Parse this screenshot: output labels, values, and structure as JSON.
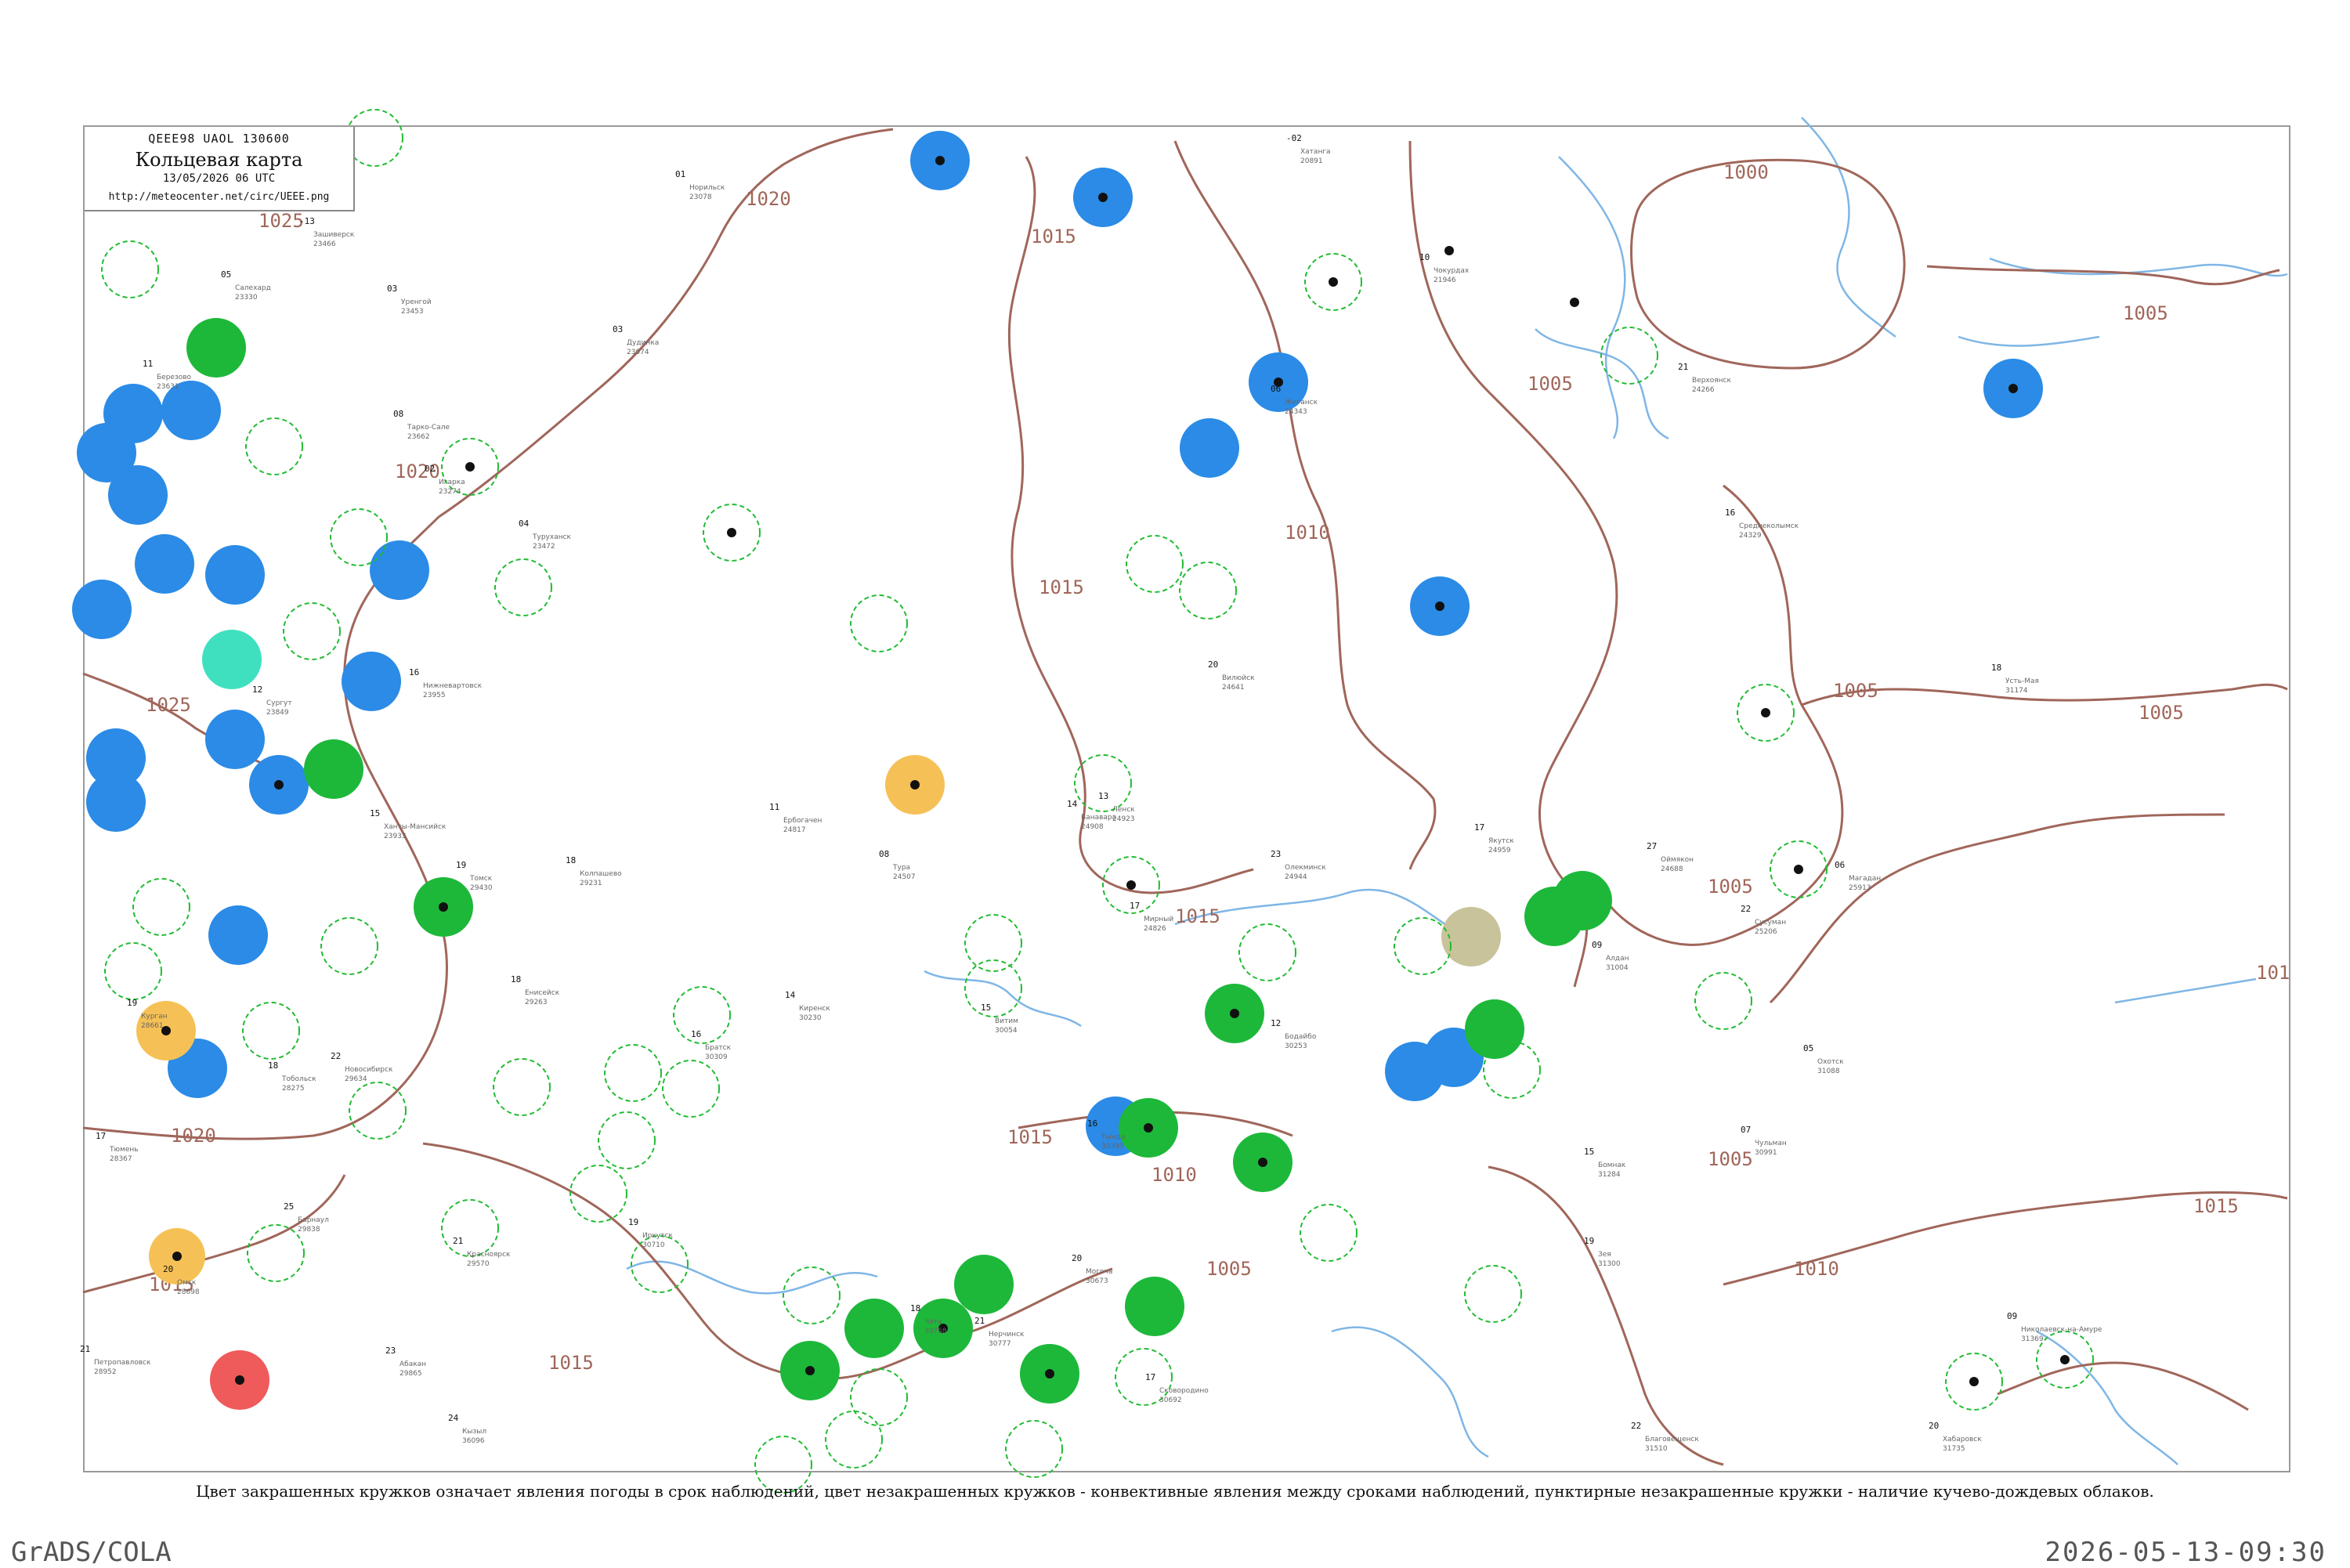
{
  "header": {
    "code": "QEEE98  UAOL  130600",
    "title": "Кольцевая карта",
    "datetime": "13/05/2026 06 UTC",
    "url": "http://meteocenter.net/circ/UEEE.png"
  },
  "caption": "Цвет закрашенных кружков означает явления погоды в срок наблюдений, цвет незакрашенных кружков - конвективные явления между сроками наблюдений, пунктирные незакрашенные кружки - наличие кучево-дождевых облаков.",
  "footer": {
    "left": "GrADS/COLA",
    "right": "2026-05-13-09:30"
  },
  "colors": {
    "isobar": "#a0665a",
    "river": "#7fb6e6",
    "ring": "#22bb33",
    "fill_blue": "#2b8be6",
    "fill_green": "#1db83a",
    "fill_orange": "#f5c156",
    "fill_red": "#ef5a5a",
    "fill_cyan": "#3fe0c0",
    "fill_khaki": "#c8c39a"
  },
  "isobar_labels": [
    "1000",
    "1005",
    "1005",
    "1005",
    "1005",
    "1005",
    "1005",
    "1005",
    "1010",
    "1010",
    "1010",
    "1015",
    "1015",
    "1015",
    "1015",
    "1015",
    "1015",
    "1015",
    "1020",
    "1020",
    "1020",
    "1025",
    "1025",
    "101"
  ],
  "stations": [
    {
      "name": "Зашиверск",
      "id": "23466",
      "t": "-13"
    },
    {
      "name": "Верхоянск",
      "id": "24266",
      "t": "21"
    },
    {
      "name": "Усть-Мая",
      "id": "31174",
      "t": "18"
    },
    {
      "name": "Оймякон",
      "id": "24688",
      "t": "27"
    },
    {
      "name": "Сусуман",
      "id": "25206",
      "t": "22"
    },
    {
      "name": "Среднеколымск",
      "id": "24329",
      "t": "16"
    },
    {
      "name": "Чокурдах",
      "id": "21946",
      "t": "10"
    },
    {
      "name": "Жиганск",
      "id": "24343",
      "t": "06"
    },
    {
      "name": "Вилюйск",
      "id": "24641",
      "t": "20"
    },
    {
      "name": "Якутск",
      "id": "24959",
      "t": "17"
    },
    {
      "name": "Олекминск",
      "id": "24944",
      "t": "23"
    },
    {
      "name": "Алдан",
      "id": "31004",
      "t": "09"
    },
    {
      "name": "Ленск",
      "id": "24923",
      "t": "13"
    },
    {
      "name": "Мирный",
      "id": "24826",
      "t": "17"
    },
    {
      "name": "Витим",
      "id": "30054",
      "t": "15"
    },
    {
      "name": "Бодайбо",
      "id": "30253",
      "t": "12"
    },
    {
      "name": "Киренск",
      "id": "30230",
      "t": "14"
    },
    {
      "name": "Братск",
      "id": "30309",
      "t": "16"
    },
    {
      "name": "Иркутск",
      "id": "30710",
      "t": "19"
    },
    {
      "name": "Чита",
      "id": "30758",
      "t": "18"
    },
    {
      "name": "Нерчинск",
      "id": "30777",
      "t": "21"
    },
    {
      "name": "Могоча",
      "id": "30673",
      "t": "20"
    },
    {
      "name": "Тында",
      "id": "30393",
      "t": "16"
    },
    {
      "name": "Сковородино",
      "id": "30692",
      "t": "17"
    },
    {
      "name": "Благовещенск",
      "id": "31510",
      "t": "22"
    },
    {
      "name": "Зея",
      "id": "31300",
      "t": "19"
    },
    {
      "name": "Бомнак",
      "id": "31284",
      "t": "15"
    },
    {
      "name": "Чульман",
      "id": "30991",
      "t": "07"
    },
    {
      "name": "Кызыл",
      "id": "36096",
      "t": "24"
    },
    {
      "name": "Абакан",
      "id": "29865",
      "t": "23"
    },
    {
      "name": "Красноярск",
      "id": "29570",
      "t": "21"
    },
    {
      "name": "Енисейск",
      "id": "29263",
      "t": "18"
    },
    {
      "name": "Туруханск",
      "id": "23472",
      "t": "04"
    },
    {
      "name": "Игарка",
      "id": "23274",
      "t": "02"
    },
    {
      "name": "Ванавара",
      "id": "24908",
      "t": "14"
    },
    {
      "name": "Тура",
      "id": "24507",
      "t": "08"
    },
    {
      "name": "Ербогачен",
      "id": "24817",
      "t": "11"
    },
    {
      "name": "Хатанга",
      "id": "20891",
      "t": "-02"
    },
    {
      "name": "Норильск",
      "id": "23078",
      "t": "01"
    },
    {
      "name": "Дудинка",
      "id": "23074",
      "t": "03"
    },
    {
      "name": "Томск",
      "id": "29430",
      "t": "19"
    },
    {
      "name": "Новосибирск",
      "id": "29634",
      "t": "22"
    },
    {
      "name": "Барнаул",
      "id": "29838",
      "t": "25"
    },
    {
      "name": "Омск",
      "id": "28698",
      "t": "20"
    },
    {
      "name": "Тюмень",
      "id": "28367",
      "t": "17"
    },
    {
      "name": "Сургут",
      "id": "23849",
      "t": "12"
    },
    {
      "name": "Ханты-Мансийск",
      "id": "23933",
      "t": "15"
    },
    {
      "name": "Салехард",
      "id": "23330",
      "t": "05"
    },
    {
      "name": "Уренгой",
      "id": "23453",
      "t": "03"
    },
    {
      "name": "Тарко-Сале",
      "id": "23662",
      "t": "08"
    },
    {
      "name": "Березово",
      "id": "23631",
      "t": "11"
    },
    {
      "name": "Колпашево",
      "id": "29231",
      "t": "18"
    },
    {
      "name": "Нижневартовск",
      "id": "23955",
      "t": "16"
    },
    {
      "name": "Тобольск",
      "id": "28275",
      "t": "18"
    },
    {
      "name": "Курган",
      "id": "28661",
      "t": "19"
    },
    {
      "name": "Петропавловск",
      "id": "28952",
      "t": "21"
    },
    {
      "name": "Магадан",
      "id": "25913",
      "t": "06"
    },
    {
      "name": "Охотск",
      "id": "31088",
      "t": "05"
    },
    {
      "name": "Николаевск-на-Амуре",
      "id": "31369",
      "t": "09"
    },
    {
      "name": "Хабаровск",
      "id": "31735",
      "t": "20"
    }
  ]
}
